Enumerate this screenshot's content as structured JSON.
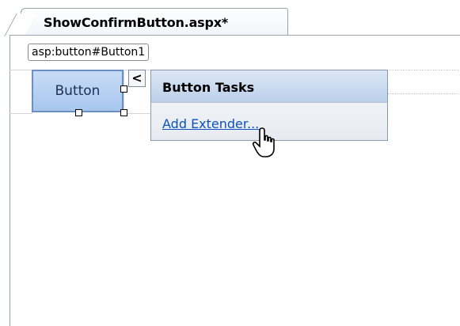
{
  "tab": {
    "title": "ShowConfirmButton.aspx*"
  },
  "designer": {
    "selected_tag": "asp:button#Button1",
    "button_text": "Button"
  },
  "smart_tag": {
    "glyph": "<",
    "panel_title": "Button Tasks",
    "actions": [
      "Add Extender..."
    ]
  },
  "colors": {
    "tab_border": "#9aa3ad",
    "button_fill": "#b7d0f1",
    "panel_header": "#c9d9ef",
    "link": "#0b52bd"
  },
  "icons": {
    "cursor": "hand-pointer-icon",
    "smart_tag": "smart-tag-chevron-icon"
  }
}
